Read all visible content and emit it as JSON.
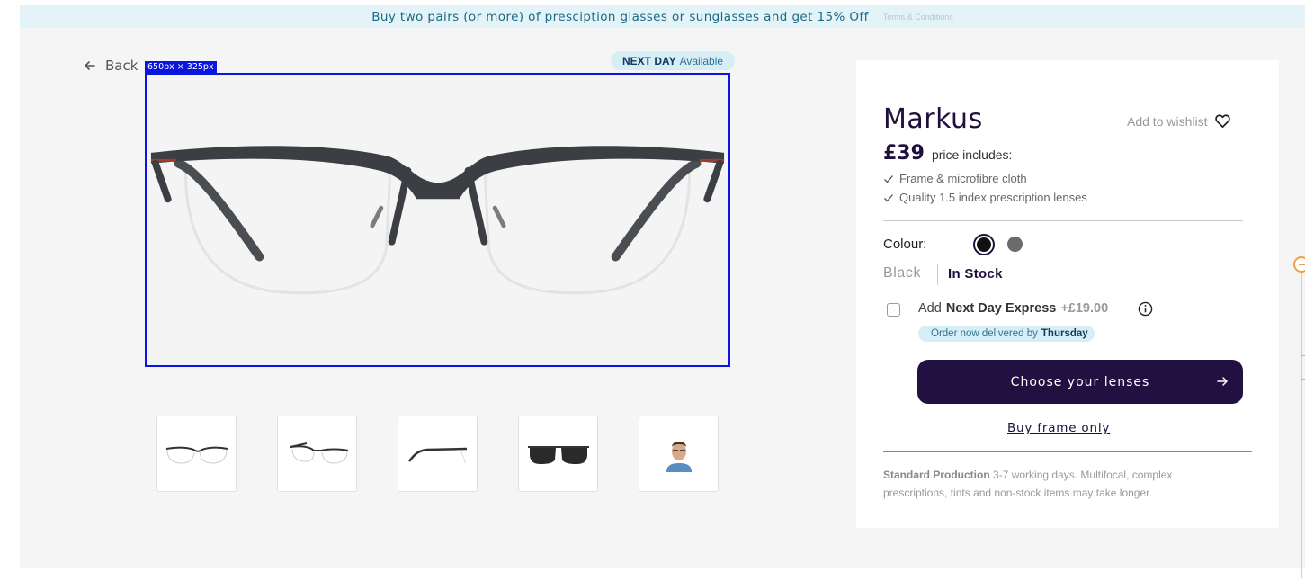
{
  "promo": {
    "text": "Buy two pairs (or more) of presciption glasses or sunglasses and get 15% Off",
    "terms": "Terms & Conditions"
  },
  "nav": {
    "back_label": "Back"
  },
  "badge": {
    "strong": "NEXT DAY",
    "light": "Available"
  },
  "image": {
    "dimension_label": "650px × 325px"
  },
  "thumbnails": [
    {
      "name": "front-view"
    },
    {
      "name": "angle-view"
    },
    {
      "name": "side-view"
    },
    {
      "name": "sunglasses-clip-view"
    },
    {
      "name": "model-view"
    }
  ],
  "product": {
    "title": "Markus",
    "wishlist_label": "Add to wishlist",
    "price": "£39",
    "price_includes": "price includes:",
    "includes": [
      "Frame & microfibre cloth",
      "Quality 1.5 index prescription lenses"
    ],
    "colour_label": "Colour:",
    "colours": [
      {
        "name": "Black",
        "hex": "#111111",
        "selected": true
      },
      {
        "name": "Grey",
        "hex": "#6b6b6b",
        "selected": false
      }
    ],
    "selected_colour": "Black",
    "stock_status": "In Stock",
    "next_day": {
      "prefix": "Add",
      "strong": "Next Day Express",
      "price": "+£19.00",
      "checked": false
    },
    "delivery": {
      "text": "Order now delivered by",
      "day": "Thursday"
    },
    "cta_label": "Choose your lenses",
    "frame_only_label": "Buy frame only",
    "production": {
      "strong": "Standard Production",
      "text": "3-7 working days. Multifocal, complex prescriptions, tints and non-stock items may take longer."
    }
  },
  "colors": {
    "brand_dark": "#221040",
    "promo_bg": "#e3f3f8",
    "badge_bg": "#d8eef6",
    "highlight_border": "#0a16e0"
  }
}
